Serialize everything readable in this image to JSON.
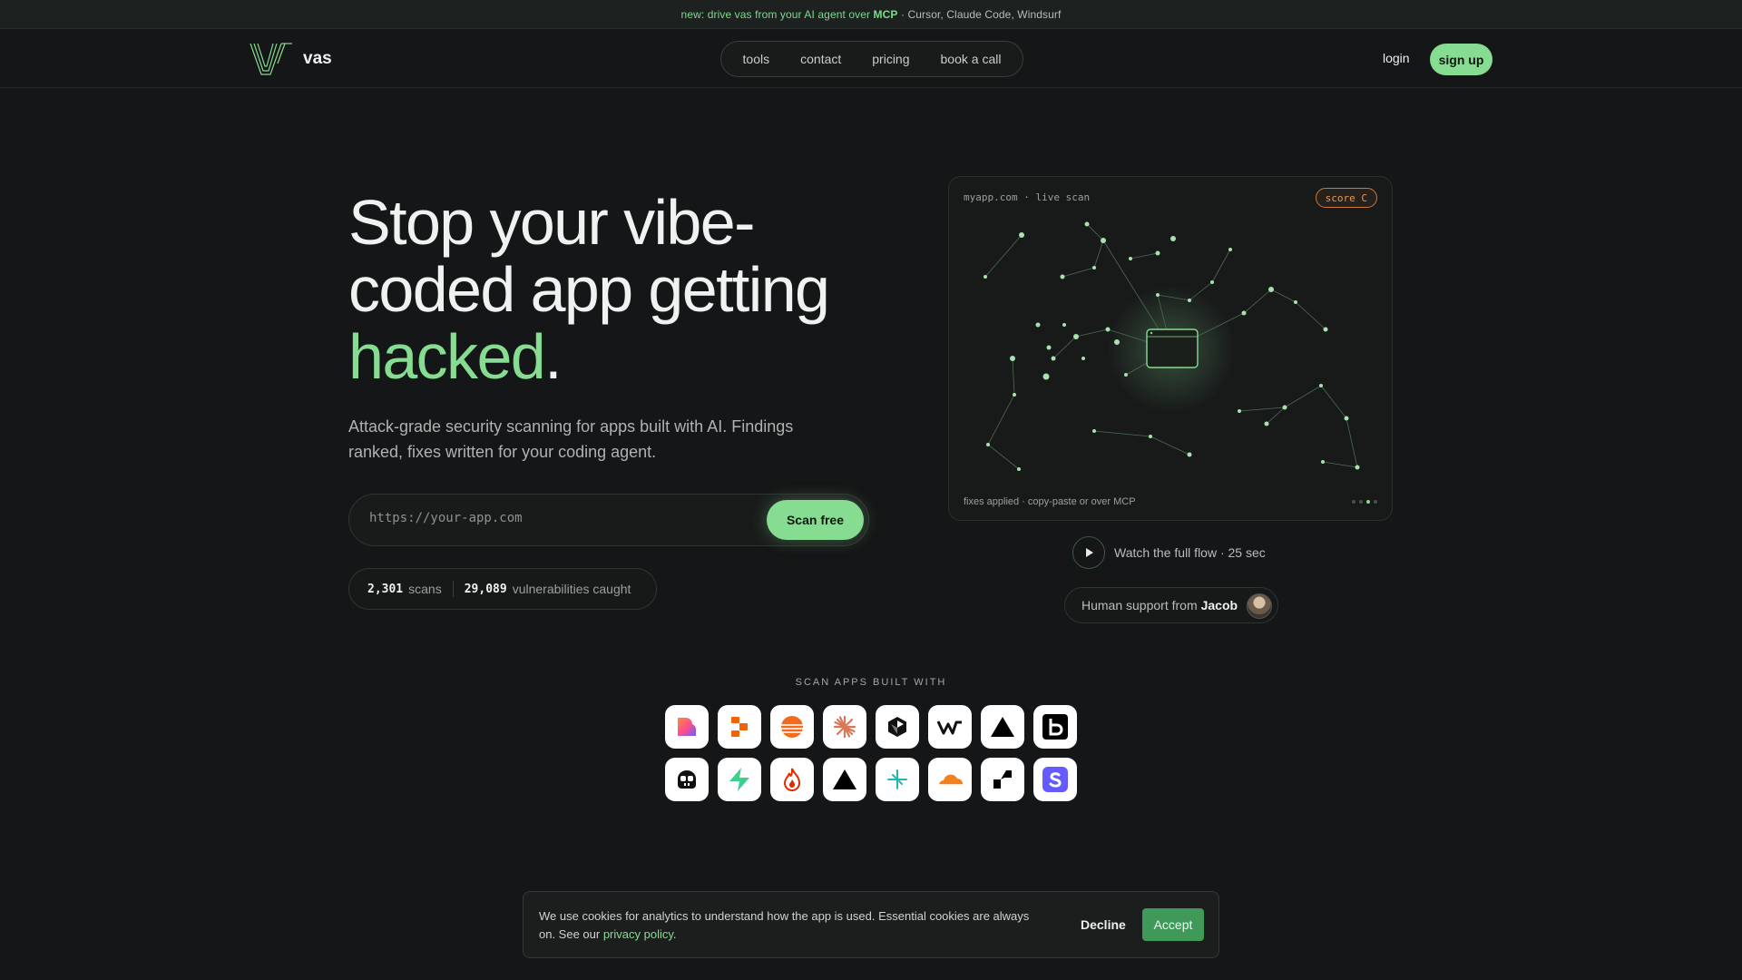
{
  "announcement": {
    "prefix": "new: drive vas from your AI agent over ",
    "strong": "MCP",
    "suffix": " · Cursor, Claude Code, Windsurf"
  },
  "header": {
    "brand": "vas",
    "nav": [
      "tools",
      "contact",
      "pricing",
      "book a call"
    ],
    "login": "login",
    "signup": "sign up"
  },
  "hero": {
    "title_line1": "Stop your vibe-",
    "title_line2": "coded app getting",
    "title_accent": "hacked",
    "title_end": ".",
    "subtitle": "Attack-grade security scanning for apps built with AI. Findings ranked, fixes written for your coding agent.",
    "input_placeholder": "https://your-app.com",
    "scan_button": "Scan free",
    "stats": {
      "scans_value": "2,301",
      "scans_label": "scans",
      "vulns_value": "29,089",
      "vulns_label": "vulnerabilities caught"
    }
  },
  "scan_card": {
    "title": "myapp.com · live scan",
    "score": "score C",
    "footer": "fixes applied · copy-paste or over MCP"
  },
  "watch": {
    "label": "Watch the full flow · 25 sec"
  },
  "support": {
    "prefix": "Human support from",
    "name": "Jacob"
  },
  "built_with": {
    "label": "SCAN APPS BUILT WITH",
    "tools": [
      "lovable-icon",
      "replit-icon",
      "bolt-icon",
      "claude-icon",
      "cursor-icon",
      "windsurf-icon",
      "vercel-icon",
      "base44-icon",
      "copilot-icon",
      "supabase-icon",
      "firebase-icon",
      "v0-icon",
      "n8n-icon",
      "cloudflare-icon",
      "railway-icon",
      "stripe-icon"
    ]
  },
  "cookie": {
    "text": "We use cookies for analytics to understand how the app is used. Essential cookies are always on. See our ",
    "link": "privacy policy",
    "end": ".",
    "decline": "Decline",
    "accept": "Accept"
  },
  "colors": {
    "accent": "#86dc91",
    "background": "#151617",
    "score": "#e59a54"
  }
}
